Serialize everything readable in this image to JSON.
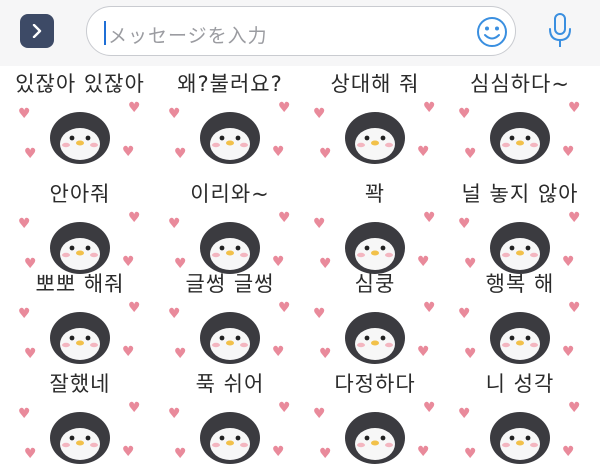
{
  "input": {
    "placeholder": "メッセージを入力"
  },
  "icons": {
    "expand": "chevron-right-icon",
    "emoji": "smiley-face-icon",
    "mic": "microphone-icon"
  },
  "colors": {
    "accent": "#3a8fe0",
    "expand_button": "#3d4a66",
    "heart": "#e98a9b"
  },
  "stickers": [
    {
      "text": "있잖아 있잖아"
    },
    {
      "text": "왜?불러요?"
    },
    {
      "text": "상대해 줘"
    },
    {
      "text": "심심하다~"
    },
    {
      "text": "안아줘"
    },
    {
      "text": "이리와~"
    },
    {
      "text": "꽉"
    },
    {
      "text": "널 놓지 않아"
    },
    {
      "text": "뽀뽀 해줘"
    },
    {
      "text": "글썽 글썽"
    },
    {
      "text": "심쿵"
    },
    {
      "text": "행복 해"
    },
    {
      "text": "잘했네"
    },
    {
      "text": "푹 쉬어"
    },
    {
      "text": "다정하다"
    },
    {
      "text": "니 성각"
    }
  ]
}
